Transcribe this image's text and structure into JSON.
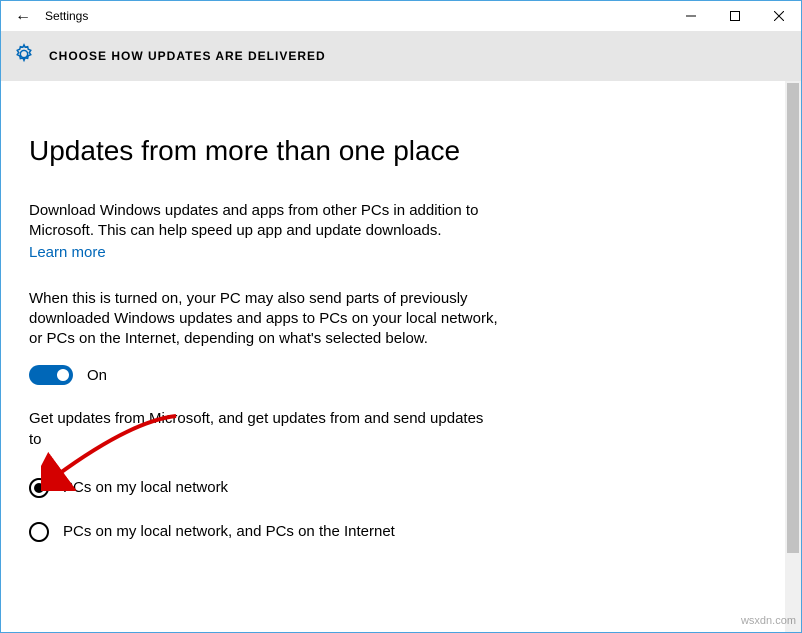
{
  "titlebar": {
    "back_icon": "←",
    "title": "Settings"
  },
  "subheader": {
    "caption": "CHOOSE HOW UPDATES ARE DELIVERED"
  },
  "main": {
    "heading": "Updates from more than one place",
    "intro": "Download Windows updates and apps from other PCs in addition to Microsoft. This can help speed up app and update downloads.",
    "learn_more": "Learn more",
    "explain": "When this is turned on, your PC may also send parts of previously downloaded Windows updates and apps to PCs on your local network, or PCs on the Internet, depending on what's selected below.",
    "toggle_state": "On",
    "prompt": "Get updates from Microsoft, and get updates from and send updates to",
    "options": [
      {
        "label": "PCs on my local network",
        "checked": true
      },
      {
        "label": "PCs on my local network, and PCs on the Internet",
        "checked": false
      }
    ]
  },
  "watermark": "wsxdn.com"
}
